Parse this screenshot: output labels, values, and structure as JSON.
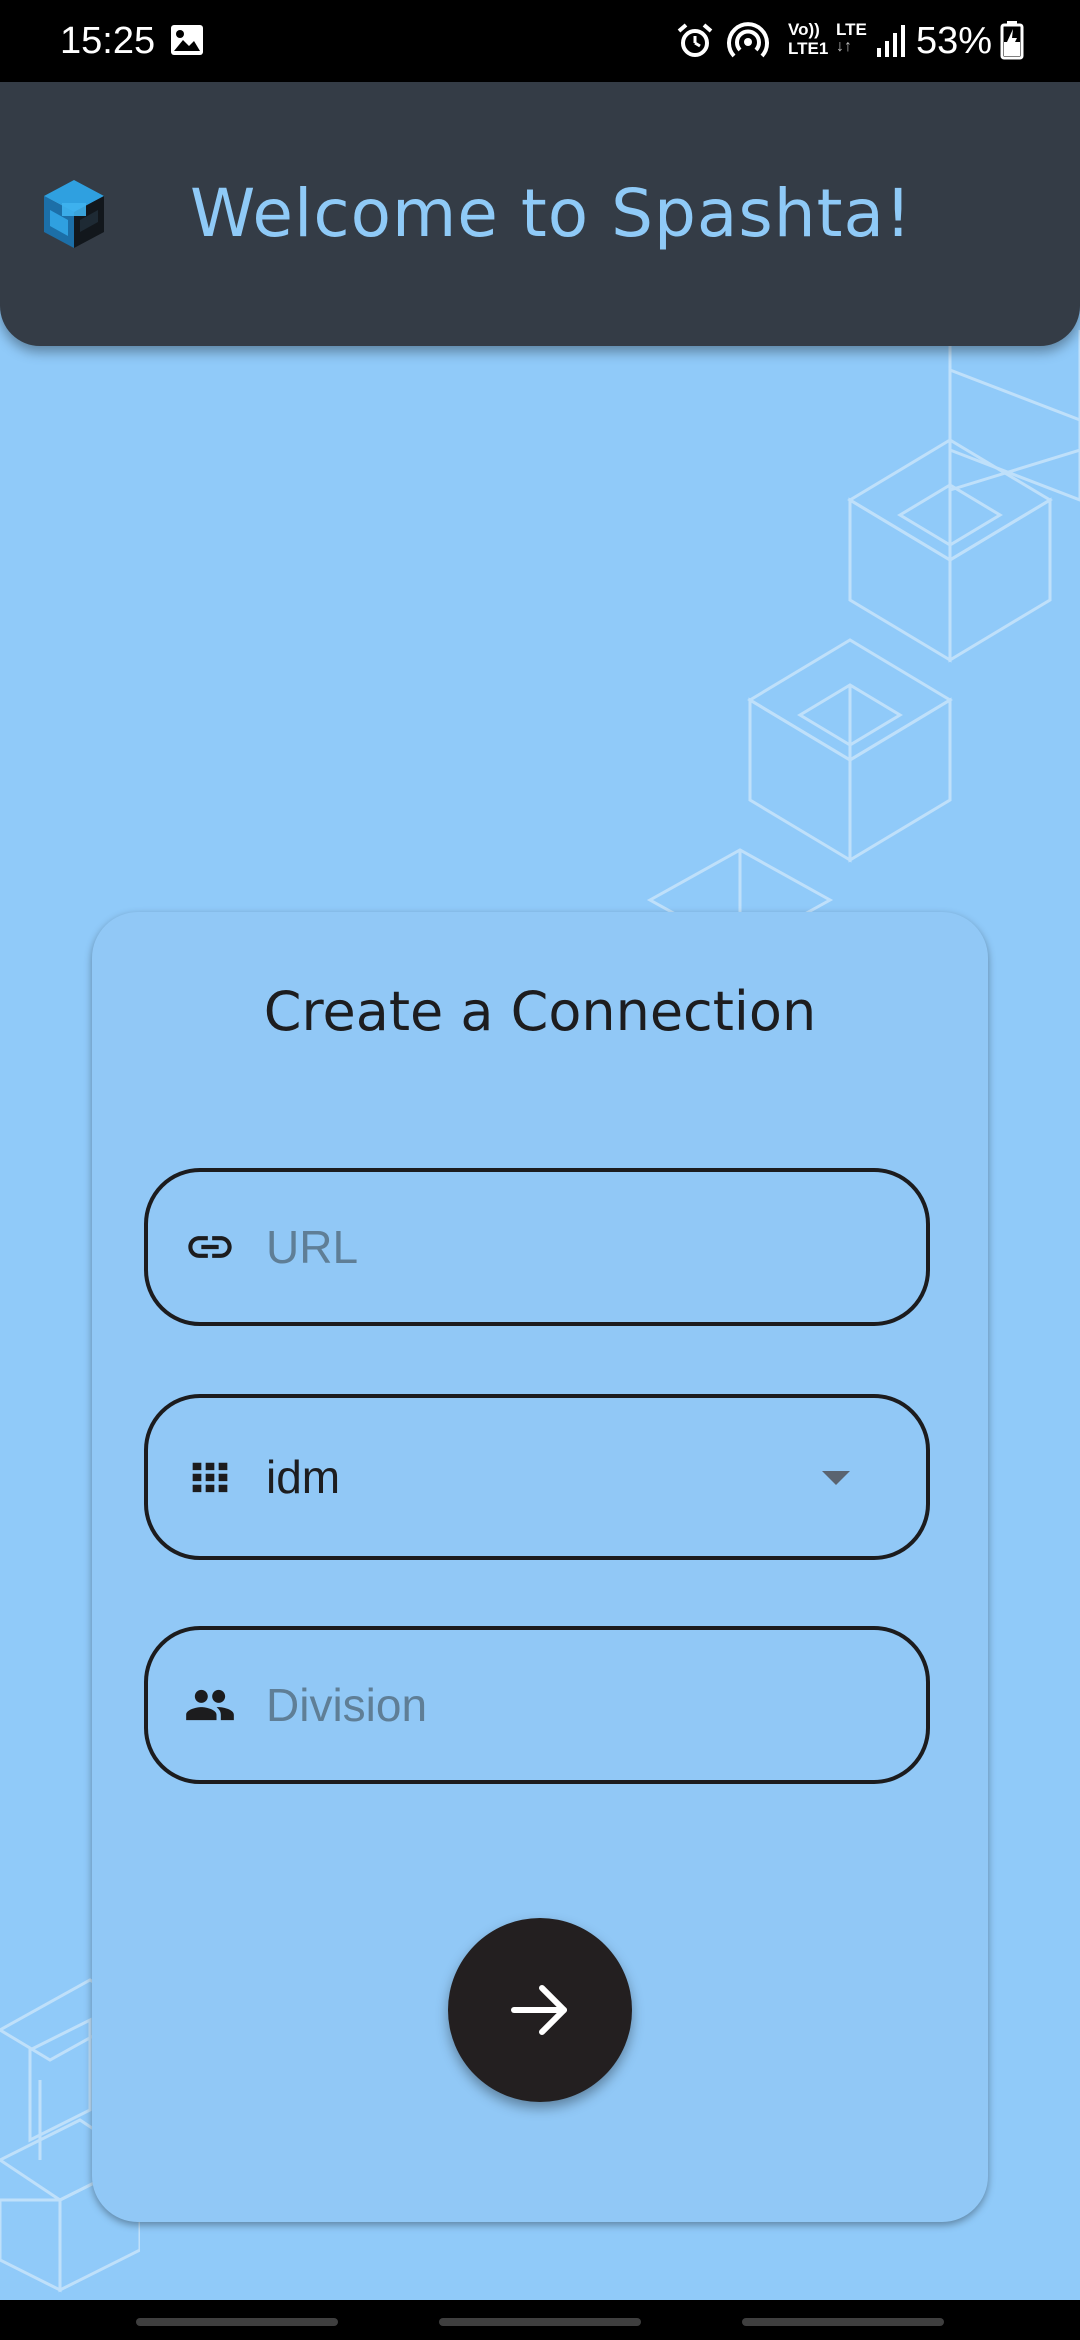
{
  "status_bar": {
    "time": "15:25",
    "battery": "53%",
    "icons": [
      "gallery-icon",
      "alarm-icon",
      "hotspot-icon",
      "volte-icon",
      "lte-icon",
      "signal-icon",
      "battery-icon"
    ],
    "volte_label_top": "Vo))",
    "volte_label_bottom": "LTE1",
    "lte_label": "LTE"
  },
  "app_bar": {
    "title": "Welcome to Spashta!",
    "logo_icon": "spashta-cube-logo",
    "background": "#343c46",
    "title_color": "#8fcaf7"
  },
  "connection_form": {
    "title": "Create a Connection",
    "url": {
      "icon": "link-icon",
      "placeholder": "URL",
      "value": ""
    },
    "project": {
      "icon": "grid-icon",
      "selected": "idm"
    },
    "division": {
      "icon": "people-icon",
      "placeholder": "Division",
      "value": ""
    },
    "submit": {
      "icon": "arrow-right-icon"
    }
  },
  "colors": {
    "background": "#90caf9",
    "card": "#91c8f6",
    "button": "#231f20"
  }
}
